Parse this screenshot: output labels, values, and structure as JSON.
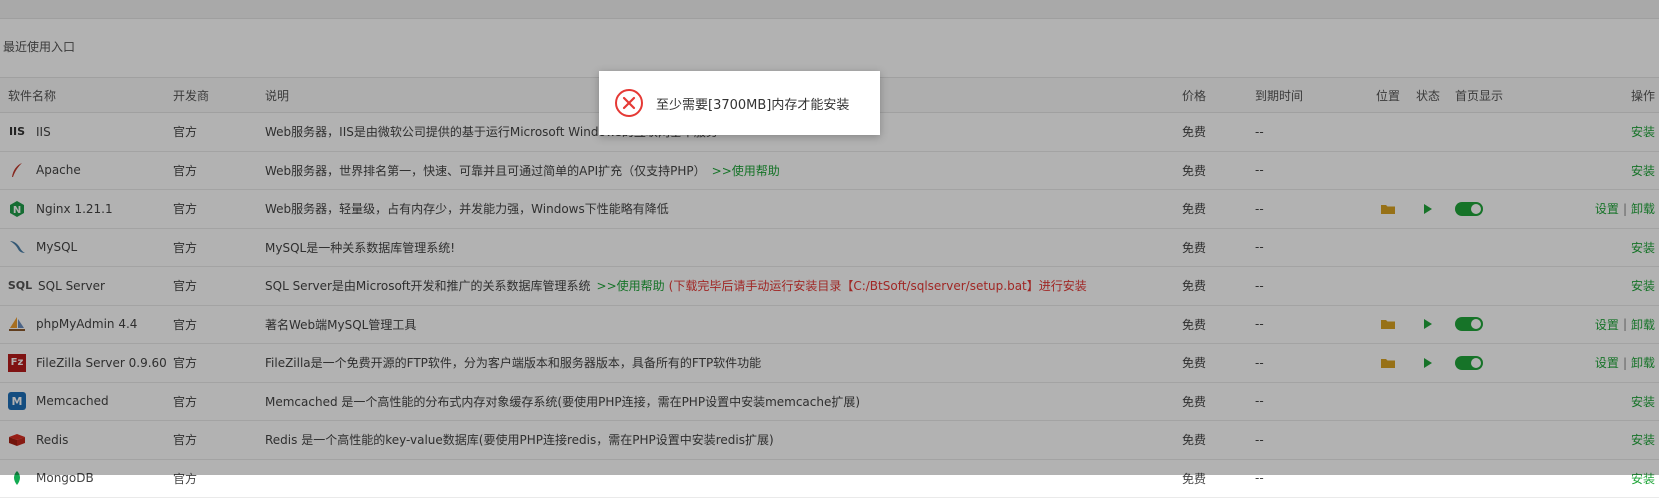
{
  "recent": {
    "label": "最近使用入口"
  },
  "columns": {
    "name": "软件名称",
    "developer": "开发商",
    "description": "说明",
    "price": "价格",
    "expire": "到期时间",
    "position": "位置",
    "status": "状态",
    "home": "首页显示",
    "op": "操作"
  },
  "rows": [
    {
      "icon": "iis-icon",
      "icon_text": "IIS",
      "name": "IIS",
      "developer": "官方",
      "desc": "Web服务器，IIS是由微软公司提供的基于运行Microsoft Windows的互联网基本服务",
      "help": "",
      "note": "",
      "price": "免费",
      "expire": "--",
      "op1": "安装",
      "op2": ""
    },
    {
      "icon": "apache-feather-icon",
      "icon_text": "",
      "name": "Apache",
      "developer": "官方",
      "desc": "Web服务器，世界排名第一，快速、可靠并且可通过简单的API扩充（仅支持PHP）",
      "help": ">>使用帮助",
      "note": "",
      "price": "免费",
      "expire": "--",
      "op1": "安装",
      "op2": ""
    },
    {
      "icon": "nginx-icon",
      "icon_text": "N",
      "name": "Nginx 1.21.1",
      "developer": "官方",
      "desc": "Web服务器，轻量级，占有内存少，并发能力强，Windows下性能略有降低",
      "help": "",
      "note": "",
      "price": "免费",
      "expire": "--",
      "op1": "设置",
      "op2": "卸载"
    },
    {
      "icon": "mysql-dolphin-icon",
      "icon_text": "",
      "name": "MySQL",
      "developer": "官方",
      "desc": "MySQL是一种关系数据库管理系统!",
      "help": "",
      "note": "",
      "price": "免费",
      "expire": "--",
      "op1": "安装",
      "op2": ""
    },
    {
      "icon": "sql-server-icon",
      "icon_text": "SQL",
      "name": "SQL Server",
      "developer": "官方",
      "desc": "SQL Server是由Microsoft开发和推广的关系数据库管理系统",
      "help": ">>使用帮助",
      "note": "(下载完毕后请手动运行安装目录【C:/BtSoft/sqlserver/setup.bat】进行安装",
      "price": "免费",
      "expire": "--",
      "op1": "安装",
      "op2": ""
    },
    {
      "icon": "phpmyadmin-sail-icon",
      "icon_text": "",
      "name": "phpMyAdmin 4.4",
      "developer": "官方",
      "desc": "著名Web端MySQL管理工具",
      "help": "",
      "note": "",
      "price": "免费",
      "expire": "--",
      "op1": "设置",
      "op2": "卸载"
    },
    {
      "icon": "filezilla-icon",
      "icon_text": "Fz",
      "name": "FileZilla Server 0.9.60",
      "developer": "官方",
      "desc": "FileZilla是一个免费开源的FTP软件，分为客户端版本和服务器版本，具备所有的FTP软件功能",
      "help": "",
      "note": "",
      "price": "免费",
      "expire": "--",
      "op1": "设置",
      "op2": "卸载"
    },
    {
      "icon": "memcached-icon",
      "icon_text": "M",
      "name": "Memcached",
      "developer": "官方",
      "desc": "Memcached 是一个高性能的分布式内存对象缓存系统(要使用PHP连接，需在PHP设置中安装memcache扩展)",
      "help": "",
      "note": "",
      "price": "免费",
      "expire": "--",
      "op1": "安装",
      "op2": ""
    },
    {
      "icon": "redis-icon",
      "icon_text": "",
      "name": "Redis",
      "developer": "官方",
      "desc": "Redis 是一个高性能的key-value数据库(要使用PHP连接redis，需在PHP设置中安装redis扩展)",
      "help": "",
      "note": "",
      "price": "免费",
      "expire": "--",
      "op1": "安装",
      "op2": ""
    },
    {
      "icon": "mongodb-leaf-icon",
      "icon_text": "",
      "name": "MongoDB",
      "developer": "官方",
      "desc": "",
      "help": "",
      "note": "",
      "price": "免费",
      "expire": "--",
      "op1": "安装",
      "op2": ""
    }
  ],
  "dialog": {
    "message": "至少需要[3700MB]内存才能安装"
  },
  "colors": {
    "accent": "#20a53a",
    "warning": "#e53935",
    "folder": "#d9a322"
  }
}
